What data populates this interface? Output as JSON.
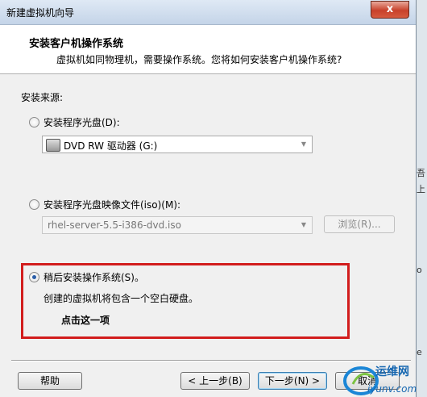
{
  "window": {
    "title": "新建虚拟机向导",
    "close": "x"
  },
  "header": {
    "title": "安装客户机操作系统",
    "subtitle": "虚拟机如同物理机，需要操作系统。您将如何安装客户机操作系统?"
  },
  "source_label": "安装来源:",
  "options": {
    "disc": {
      "label": "安装程序光盘(D):",
      "drive": "DVD RW 驱动器 (G:)",
      "selected": false
    },
    "iso": {
      "label": "安装程序光盘映像文件(iso)(M):",
      "path": "rhel-server-5.5-i386-dvd.iso",
      "browse": "浏览(R)...",
      "selected": false
    },
    "later": {
      "label": "稍后安装操作系统(S)。",
      "description": "创建的虚拟机将包含一个空白硬盘。",
      "selected": true
    }
  },
  "annotation": {
    "text": "点击这一项",
    "color": "#d21d1d"
  },
  "buttons": {
    "help": "帮助",
    "back": "< 上一步(B)",
    "next": "下一步(N) >",
    "cancel": "取消"
  },
  "right_strip": {
    "chars": [
      "吾",
      "上",
      "o",
      "e"
    ]
  },
  "watermark": {
    "line1": "运维网",
    "line2": "iyunv.com"
  }
}
